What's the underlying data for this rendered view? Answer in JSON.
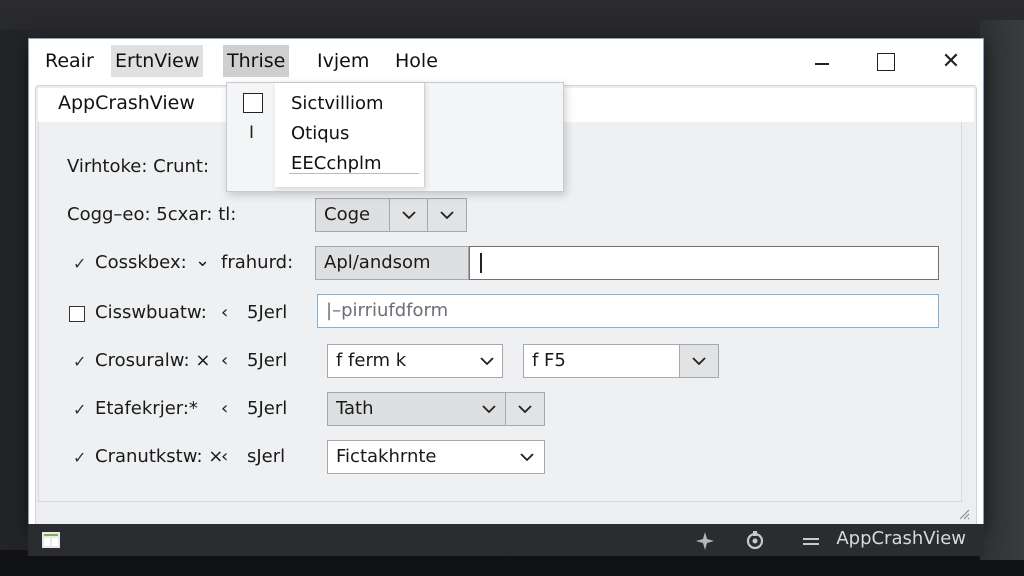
{
  "menubar": {
    "items": [
      "Reair",
      "ErtnView",
      "Thrise",
      "Ivjem",
      "Hole"
    ]
  },
  "window_controls": {
    "close_glyph": "✕"
  },
  "tab": {
    "title": "AppCrashView"
  },
  "dropdown_menu": {
    "items": [
      "Sictvilliom",
      "Otiqus",
      "EECchplm"
    ],
    "mark_glyph": "I"
  },
  "form": {
    "row1": {
      "label": "Virhtoke: Crunt:"
    },
    "row2": {
      "label": "Cogg–eo: 5cxar: tl:",
      "value": "Coge"
    },
    "row3": {
      "mark": "✓",
      "label": "Cosskbex:",
      "arrow": "⌄",
      "sub_label": "frahurd:",
      "prefix_value": "Apl/andsom",
      "value": ""
    },
    "row4": {
      "label": "Cisswbuatw:",
      "arrow": "‹",
      "sub_label": "5Jerl",
      "placeholder": "|–pirriufdform"
    },
    "row5": {
      "mark": "✓",
      "label": "Crosuralw: ×",
      "arrow": "‹",
      "sub_label": "5Jerl",
      "value_a": "f  ferm k",
      "value_b": "f      F5"
    },
    "row6": {
      "mark": "✓",
      "label": "Etafekrjer:*",
      "arrow": "‹",
      "sub_label": "5Jerl",
      "value": "Tath"
    },
    "row7": {
      "mark": "✓",
      "label": "Cranutkstw: ×",
      "arrow": "‹",
      "sub_label": "sJerl",
      "value": "Fictakhrnte"
    }
  },
  "taskbar": {
    "app_label": "AppCrashView",
    "icons": [
      "sparkle-icon",
      "refresh-icon",
      "menu-icon"
    ]
  }
}
